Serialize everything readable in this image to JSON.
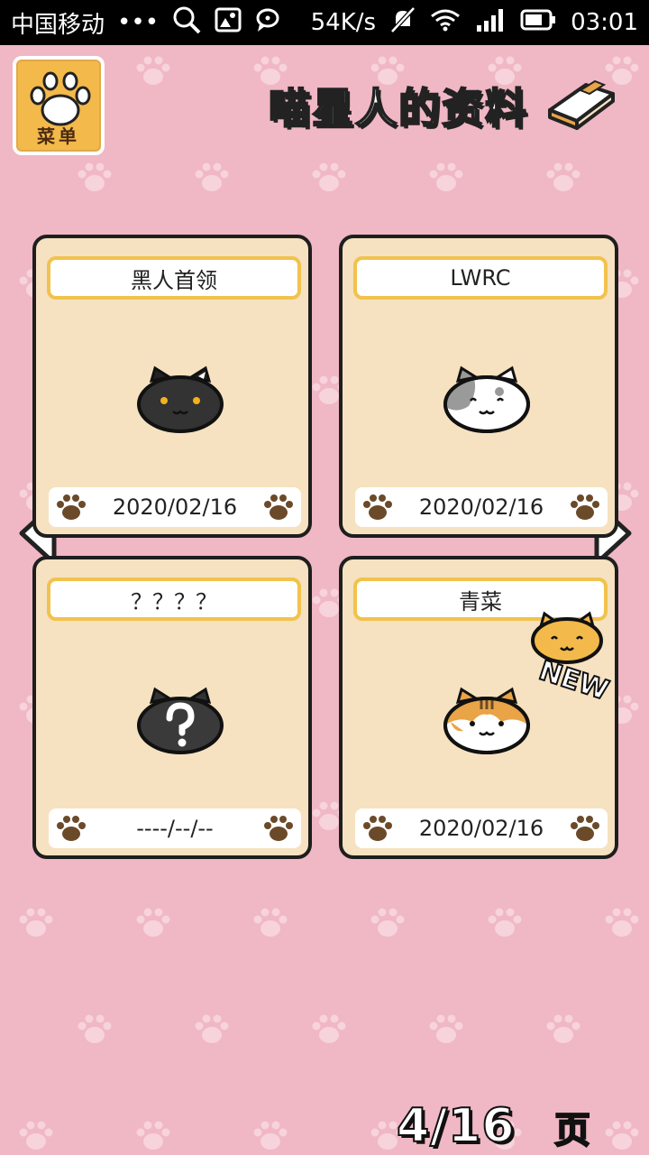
{
  "status_bar": {
    "carrier": "中国移动",
    "dots": "•••",
    "net_speed": "54K/s",
    "time": "03:01"
  },
  "menu": {
    "label": "菜单",
    "icon": "paw-icon"
  },
  "header": {
    "title": "喵星人的资料",
    "icon": "book-icon"
  },
  "cards": [
    {
      "name": "黑人首领",
      "date": "2020/02/16",
      "cat": "black-cat-icon"
    },
    {
      "name": "LWRC",
      "date": "2020/02/16",
      "cat": "gray-white-cat-icon"
    },
    {
      "name": "？？？？",
      "date": "----/--/--",
      "cat": "unknown-cat-icon"
    },
    {
      "name": "青菜",
      "date": "2020/02/16",
      "cat": "orange-tabby-cat-icon",
      "badge": "NEW"
    }
  ],
  "pager": {
    "text": "4/16",
    "suffix": "页"
  },
  "colors": {
    "background": "#f0b7c4",
    "card": "#f6e2c0",
    "name_border": "#f1c24d",
    "paw_brown": "#6b4a2a"
  }
}
